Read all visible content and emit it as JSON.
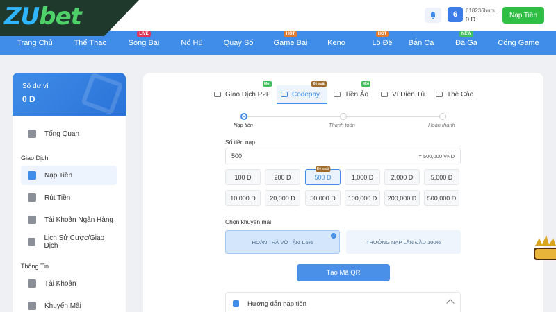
{
  "brand": {
    "logo_part1": "ZU",
    "logo_part2": "bet"
  },
  "header": {
    "username": "618236huhu",
    "balance": "0 D",
    "vip_level": "6",
    "deposit_button": "Nạp Tiền"
  },
  "nav": {
    "items": [
      {
        "label": "Trang Chủ",
        "badge": ""
      },
      {
        "label": "Thể Thao",
        "badge": ""
      },
      {
        "label": "Sòng Bài",
        "badge": "LIVE"
      },
      {
        "label": "Nổ Hũ",
        "badge": ""
      },
      {
        "label": "Quay Số",
        "badge": ""
      },
      {
        "label": "Game Bài",
        "badge": "HOT"
      },
      {
        "label": "Keno",
        "badge": ""
      },
      {
        "label": "Lô Đề",
        "badge": "HOT"
      },
      {
        "label": "Bắn Cá",
        "badge": ""
      },
      {
        "label": "Đá Gà",
        "badge": "NEW"
      },
      {
        "label": "Cổng Game",
        "badge": ""
      }
    ]
  },
  "sidebar": {
    "wallet_label": "Số dư ví",
    "wallet_amount": "0 D",
    "overview": "Tổng Quan",
    "section_transactions": "Giao Dịch",
    "items": [
      "Nạp Tiền",
      "Rút Tiền",
      "Tài Khoản Ngân Hàng",
      "Lịch Sử Cược/Giao Dịch"
    ],
    "section_info": "Thông Tin",
    "info_items": [
      "Tài Khoản",
      "Khuyến Mãi"
    ]
  },
  "tabs": [
    {
      "label": "Giao Dịch P2P",
      "badge": "Mới"
    },
    {
      "label": "Codepay",
      "badge": "Đề xuất"
    },
    {
      "label": "Tiền Ảo",
      "badge": "Mới"
    },
    {
      "label": "Ví Điện Tử",
      "badge": ""
    },
    {
      "label": "Thẻ Cào",
      "badge": ""
    }
  ],
  "steps": [
    "Nạp tiền",
    "Thanh toán",
    "Hoàn thành"
  ],
  "deposit": {
    "amount_label": "Số tiền nạp",
    "amount_value": "500",
    "amount_converted": "= 500,000 VND",
    "recommended_badge": "Đề xuất",
    "amounts": [
      "100 D",
      "200 D",
      "500 D",
      "1,000 D",
      "2,000 D",
      "5,000 D",
      "10,000 D",
      "20,000 D",
      "50,000 D",
      "100,000 D",
      "200,000 D",
      "500,000 D"
    ],
    "selected_amount": "500 D"
  },
  "promo": {
    "label": "Chọn khuyến mãi",
    "options": [
      "HOÀN TRẢ VÔ TẬN 1.6%",
      "THƯỞNG NẠP LẦN ĐẦU 100%"
    ]
  },
  "qr_button": "Tạo Mã QR",
  "guide_title": "Hướng dẫn nạp tiền",
  "colors": {
    "primary": "#3f8de8",
    "green": "#2fbf44",
    "hot": "#e07a2e",
    "live": "#e0335a",
    "new": "#3fbf5a"
  }
}
